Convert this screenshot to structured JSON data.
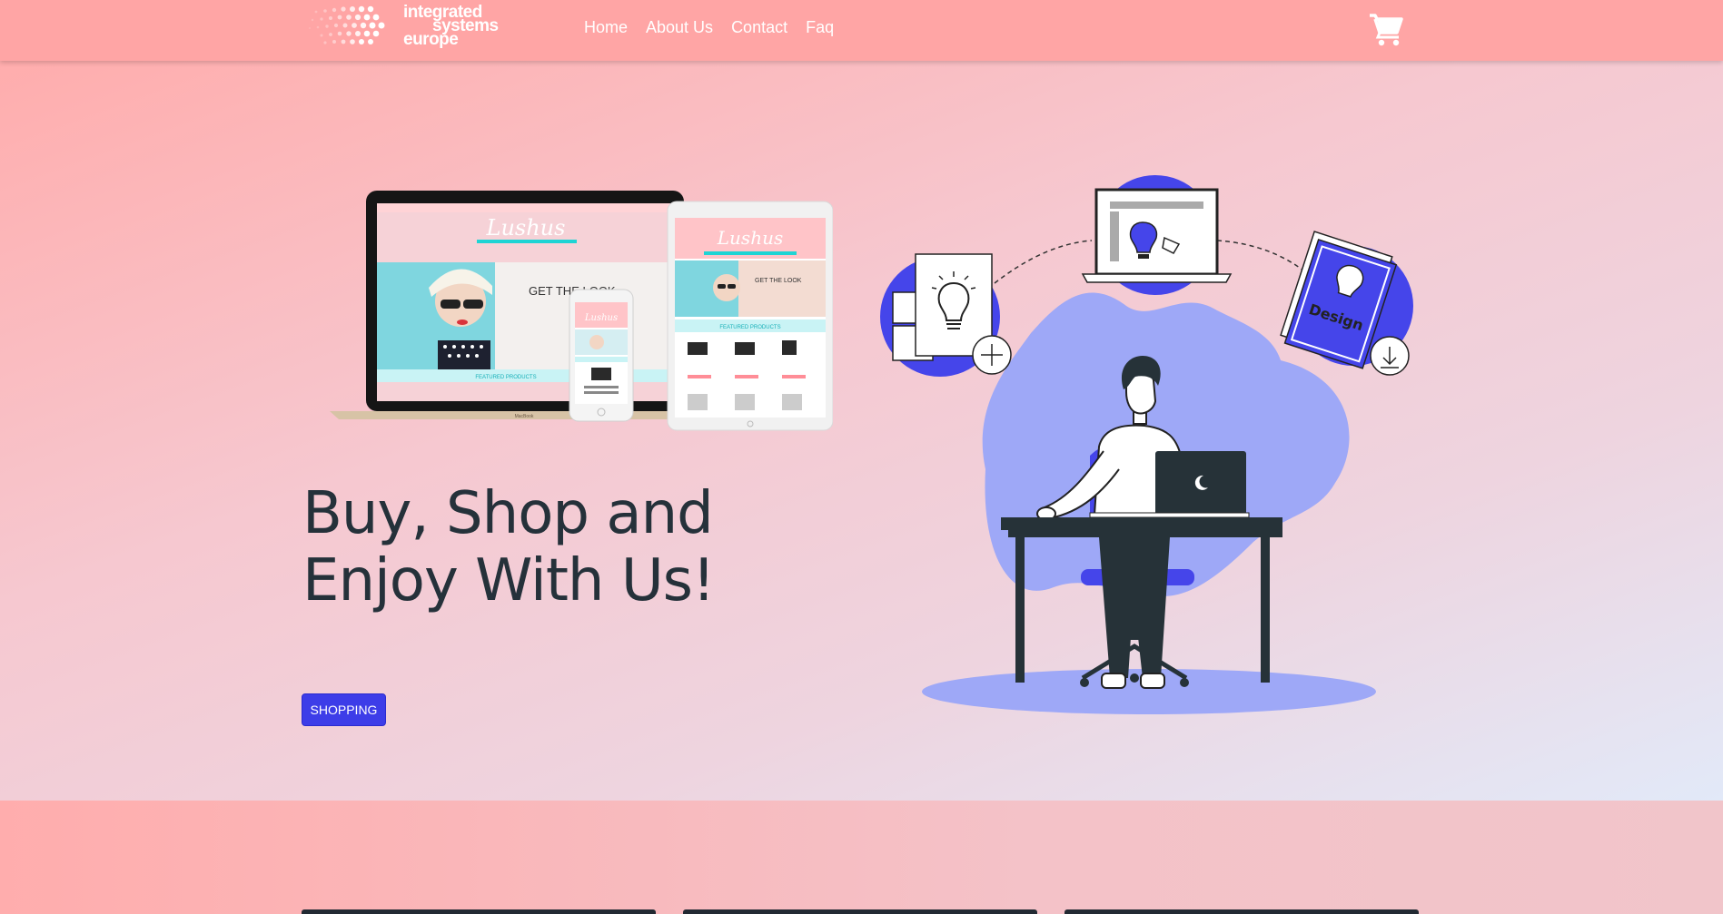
{
  "brand": {
    "line1": "integrated",
    "line2": "systems",
    "line3": "europe",
    "logo_icon": "dot-grid-logo-icon"
  },
  "nav": {
    "items": [
      {
        "label": "Home"
      },
      {
        "label": "About Us"
      },
      {
        "label": "Contact"
      },
      {
        "label": "Faq"
      }
    ],
    "cart_icon": "shopping-cart-icon"
  },
  "hero": {
    "title": "Buy, Shop and Enjoy With Us!",
    "button_label": "SHOPPING",
    "devices_image": {
      "brand_text": "Lushus",
      "banner_text": "GET THE LOOK",
      "section_text": "FEATURED PRODUCTS",
      "laptop_label": "MacBook"
    },
    "illustration": {
      "poster_text": "Design"
    }
  },
  "colors": {
    "navbar": "#ffa5a5",
    "accent": "#3d3de8",
    "text_dark": "#25313a",
    "illustration_blob": "#9ea8f7",
    "illustration_blue": "#4545ea"
  }
}
